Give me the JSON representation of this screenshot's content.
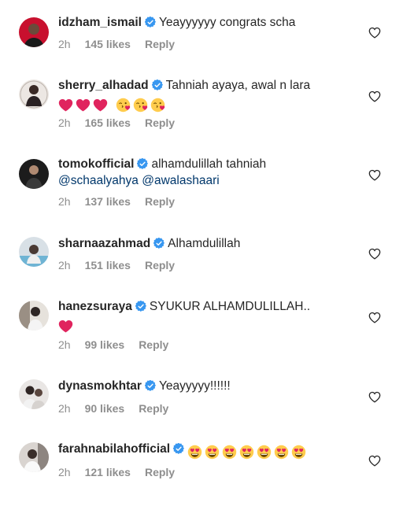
{
  "comments": [
    {
      "user": "idzham_ismail",
      "text": "Yeayyyyyy congrats scha",
      "time": "2h",
      "likes": "145 likes",
      "reply": "Reply"
    },
    {
      "user": "sherry_alhadad",
      "text": "Tahniah ayaya, awal n lara",
      "time": "2h",
      "likes": "165 likes",
      "reply": "Reply",
      "emojis": [
        "red-heart",
        "red-heart",
        "red-heart",
        "face-blowing-kiss",
        "face-blowing-kiss",
        "face-blowing-kiss"
      ]
    },
    {
      "user": "tomokofficial",
      "text": "alhamdulillah tahniah",
      "mention1": "@schaalyahya",
      "mention2": "@awalashaari",
      "time": "2h",
      "likes": "137 likes",
      "reply": "Reply"
    },
    {
      "user": "sharnaazahmad",
      "text": "Alhamdulillah",
      "time": "2h",
      "likes": "151 likes",
      "reply": "Reply"
    },
    {
      "user": "hanezsuraya",
      "text": "SYUKUR ALHAMDULILLAH..",
      "time": "2h",
      "likes": "99 likes",
      "reply": "Reply",
      "emojis": [
        "red-heart"
      ]
    },
    {
      "user": "dynasmokhtar",
      "text": "Yeayyyyy!!!!!!",
      "time": "2h",
      "likes": "90 likes",
      "reply": "Reply"
    },
    {
      "user": "farahnabilahofficial",
      "text": "",
      "time": "2h",
      "likes": "121 likes",
      "reply": "Reply",
      "emojis": [
        "heart-eyes",
        "heart-eyes",
        "heart-eyes",
        "heart-eyes",
        "heart-eyes",
        "heart-eyes",
        "heart-eyes"
      ]
    }
  ],
  "colors": {
    "verified": "#3897f0",
    "muted": "#8e8e8e",
    "mention": "#00376b",
    "heart_emoji": "#e0245e",
    "emoji_face": "#ffcc4d"
  }
}
